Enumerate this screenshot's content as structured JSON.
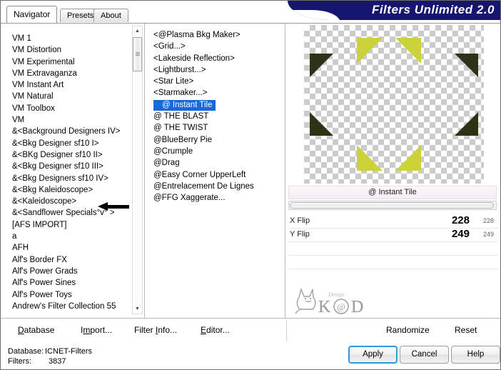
{
  "window": {
    "banner_title": "Filters Unlimited 2.0"
  },
  "tabs": [
    {
      "label": "Navigator",
      "active": true
    },
    {
      "label": "Presets",
      "active": false
    },
    {
      "label": "About",
      "active": false
    }
  ],
  "category_list": {
    "scroll_position": "near-top",
    "items": [
      "VM 1",
      "VM Distortion",
      "VM Experimental",
      "VM Extravaganza",
      "VM Instant Art",
      "VM Natural",
      "VM Toolbox",
      "VM",
      "&<Background Designers IV>",
      "&<Bkg Designer sf10 I>",
      "&<BKg Designer sf10 II>",
      "&<Bkg Designer sf10 III>",
      "&<Bkg Designers sf10 IV>",
      "&<Bkg Kaleidoscope>",
      "&<Kaleidoscope>",
      "&<Sandflower Specials°v° >",
      "[AFS IMPORT]",
      "a",
      "AFH",
      "Alf's Border FX",
      "Alf's Power Grads",
      "Alf's Power Sines",
      "Alf's Power Toys",
      "Andrew's Filter Collection 55"
    ],
    "annotated_item_index": 12
  },
  "filter_list": {
    "selected": "@ Instant Tile",
    "items": [
      "<@Plasma Bkg Maker>",
      "<Grid...>",
      "<Lakeside Reflection>",
      "<Lightburst...>",
      "<Star Lite>",
      "<Starmaker...>",
      "@ Instant Tile",
      "@ THE BLAST",
      "@ THE TWIST",
      "@BlueBerry Pie",
      "@Crumple",
      "@Drag",
      "@Easy Corner UpperLeft",
      "@Entrelacement De Lignes",
      "@FFG Xaggerate..."
    ]
  },
  "preview": {
    "filter_name": "@ Instant Tile",
    "colors": {
      "light_triangle": "#ccd33a",
      "dark_triangle": "#2e3318",
      "checker_light": "#ffffff",
      "checker_dark": "#cccccc"
    }
  },
  "parameters": [
    {
      "label": "X Flip",
      "value": "228",
      "value_small": "228"
    },
    {
      "label": "Y Flip",
      "value": "249",
      "value_small": "249"
    }
  ],
  "watermark": {
    "text": "K@D",
    "sub_text": "Design"
  },
  "toolbar": {
    "database": "Database",
    "database_accel": "D",
    "import": "Import...",
    "import_accel": "I",
    "filter_info": "Filter Info...",
    "filter_info_accel": "I",
    "editor": "Editor...",
    "editor_accel": "E",
    "randomize": "Randomize",
    "reset": "Reset"
  },
  "status": {
    "database_label": "Database:",
    "database_value": "ICNET-Filters",
    "filters_label": "Filters:",
    "filters_value": "3837"
  },
  "footer_buttons": {
    "apply": "Apply",
    "cancel": "Cancel",
    "help": "Help"
  },
  "accent": {
    "banner_blue": "#161670",
    "selection_blue": "#1868d6",
    "focus_blue": "#2e9bd6"
  }
}
